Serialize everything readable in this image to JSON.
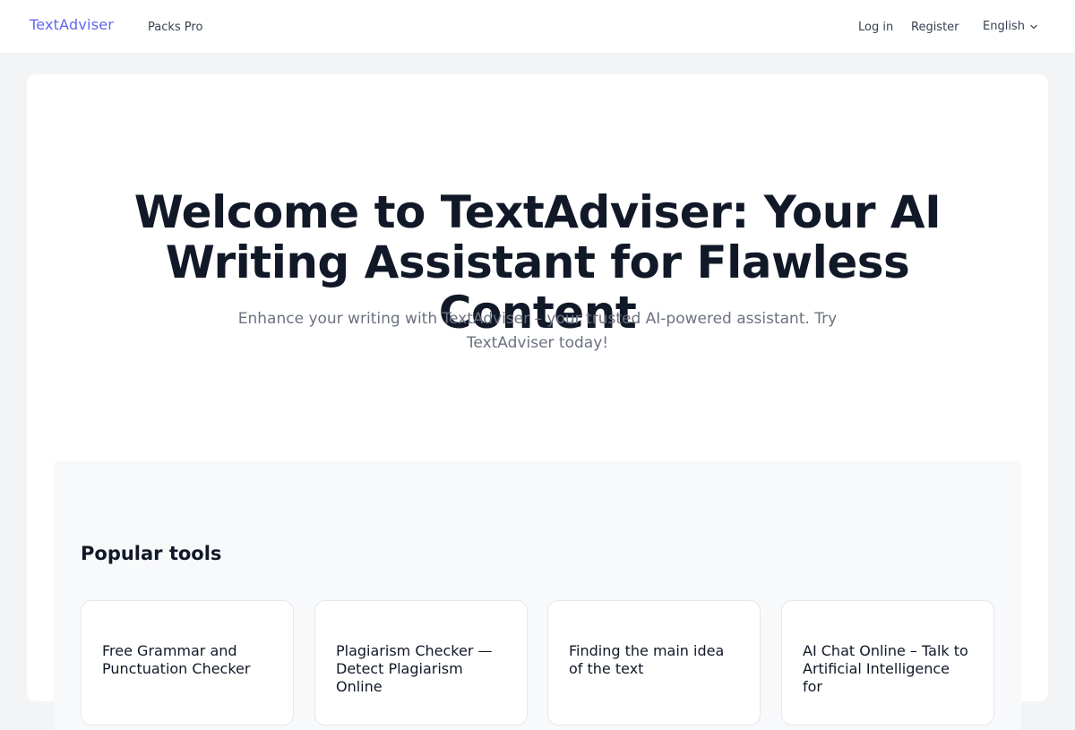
{
  "header": {
    "logo": "TextAdviser",
    "packs_link": "Packs Pro",
    "login_link": "Log in",
    "register_link": "Register",
    "language": "English",
    "brand_color": "#6366f1"
  },
  "hero": {
    "title": "Welcome to TextAdviser: Your AI Writing Assistant for Flawless Content",
    "subtitle": "Enhance your writing with TextAdviser – your trusted AI-powered assistant. Try TextAdviser today!"
  },
  "tools": {
    "heading": "Popular tools",
    "items": [
      {
        "title": "Free Grammar and Punctuation Checker"
      },
      {
        "title": "Plagiarism Checker — Detect Plagiarism Online"
      },
      {
        "title": "Finding the main idea of the text"
      },
      {
        "title": "AI Chat Online – Talk to Artificial Intelligence for"
      }
    ]
  },
  "icons": {
    "language_dropdown": "chevron-down-icon"
  }
}
